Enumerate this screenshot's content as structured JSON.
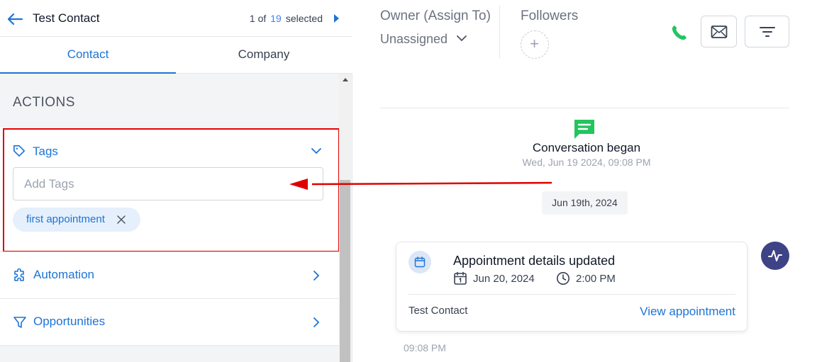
{
  "header": {
    "contact_name": "Test Contact",
    "pager_prefix": "1 of",
    "pager_total": "19",
    "pager_suffix": "selected"
  },
  "tabs": [
    {
      "label": "Contact",
      "active": true
    },
    {
      "label": "Company",
      "active": false
    }
  ],
  "actions": {
    "title": "ACTIONS",
    "tags": {
      "label": "Tags",
      "input_placeholder": "Add Tags",
      "input_value": "",
      "chips": [
        {
          "label": "first appointment"
        }
      ]
    },
    "rows": [
      {
        "label": "Automation",
        "icon": "puzzle-icon"
      },
      {
        "label": "Opportunities",
        "icon": "funnel-icon"
      }
    ]
  },
  "right_header": {
    "owner_label": "Owner (Assign To)",
    "owner_value": "Unassigned",
    "followers_label": "Followers",
    "add_follower_symbol": "+"
  },
  "timeline": {
    "conversation_title": "Conversation began",
    "conversation_time": "Wed, Jun 19 2024, 09:08 PM",
    "date_separator": "Jun 19th, 2024",
    "appointment": {
      "title": "Appointment details updated",
      "date": "Jun 20, 2024",
      "time": "2:00 PM",
      "contact": "Test Contact",
      "link_label": "View appointment"
    },
    "message_time": "09:08 PM"
  },
  "colors": {
    "accent": "#1d74d6",
    "highlight": "#e00000",
    "phone": "#22c55e",
    "conversation_icon": "#22c55e",
    "activity_button": "#3d4385"
  }
}
